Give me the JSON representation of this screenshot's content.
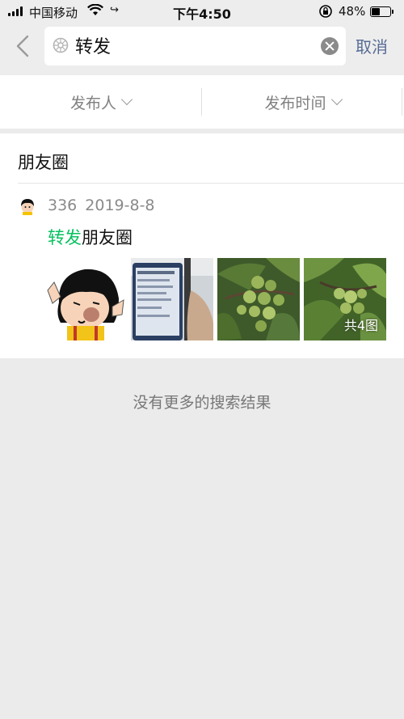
{
  "status_bar": {
    "carrier": "中国移动",
    "time": "下午4:50",
    "battery_percent": "48%",
    "battery_level": 0.48,
    "signal_icon": "signal-icon",
    "wifi_icon": "wifi-icon",
    "location_icon": "location-arrow-icon",
    "lock_icon": "rotation-lock-icon"
  },
  "search": {
    "query": "转发",
    "cancel_label": "取消",
    "search_icon": "search-icon",
    "clear_icon": "clear-icon",
    "back_icon": "back-chevron-icon"
  },
  "filters": [
    {
      "label": "发布人"
    },
    {
      "label": "发布时间"
    }
  ],
  "results": {
    "section_title": "朋友圈",
    "items": [
      {
        "author": "336",
        "date": "2019-8-8",
        "text_highlight": "转发",
        "text_rest": "朋友圈",
        "image_count_label": "共4图"
      }
    ]
  },
  "footer": {
    "no_more": "没有更多的搜索结果"
  },
  "colors": {
    "accent_green": "#07c160",
    "link_blue": "#576b95",
    "background": "#ebebeb"
  }
}
